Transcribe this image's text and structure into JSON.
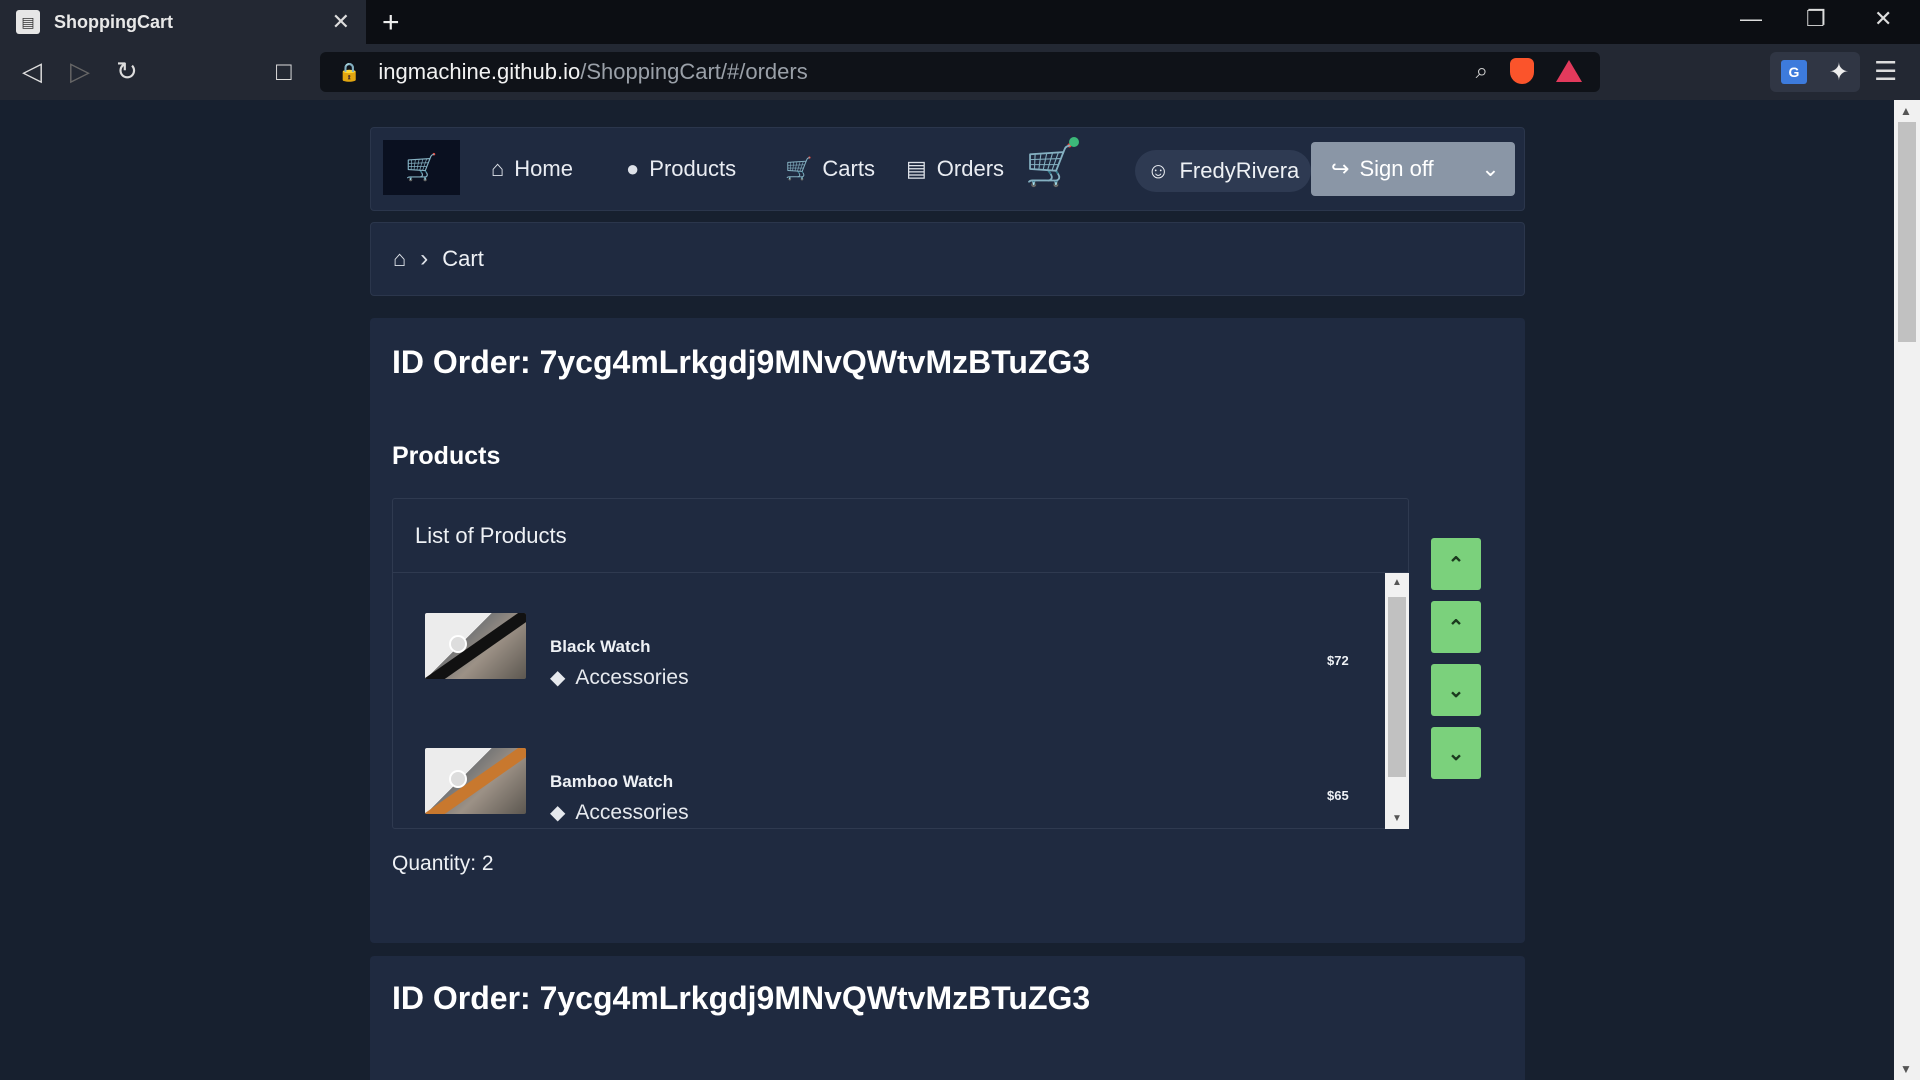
{
  "browser": {
    "tab_title": "ShoppingCart",
    "url_host": "ingmachine.github.io",
    "url_path": "/ShoppingCart/#/orders"
  },
  "nav": {
    "home": "Home",
    "products": "Products",
    "carts": "Carts",
    "orders": "Orders",
    "user": "FredyRivera",
    "signoff": "Sign off"
  },
  "breadcrumb": {
    "current": "Cart"
  },
  "orders": [
    {
      "title": "ID Order: 7ycg4mLrkgdj9MNvQWtvMzBTuZG3",
      "products_heading": "Products",
      "list_header": "List of Products",
      "products": [
        {
          "name": "Black Watch",
          "category": "Accessories",
          "price": "$72"
        },
        {
          "name": "Bamboo Watch",
          "category": "Accessories",
          "price": "$65"
        }
      ],
      "quantity": "Quantity: 2"
    },
    {
      "title": "ID Order: 7ycg4mLrkgdj9MNvQWtvMzBTuZG3"
    }
  ],
  "colors": {
    "accent_green": "#7bd17c",
    "panel": "#1f2a40",
    "background": "#17202f",
    "signoff_button": "#8a96a6"
  }
}
